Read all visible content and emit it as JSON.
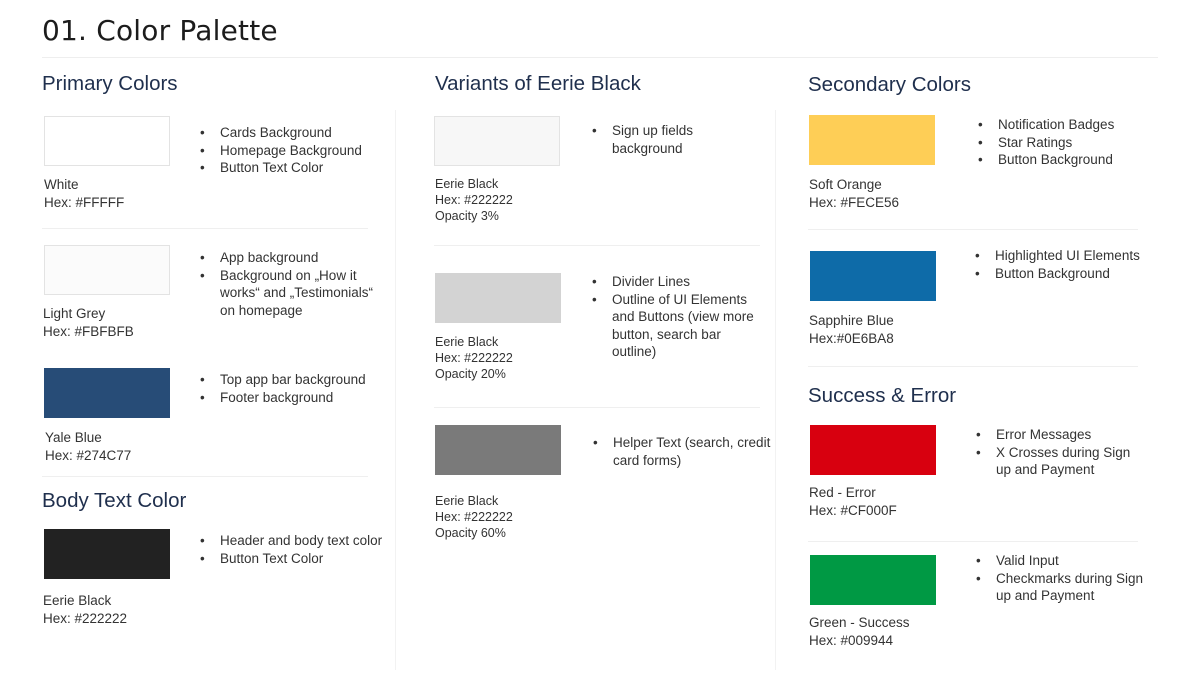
{
  "title": "01. Color Palette",
  "primary": {
    "heading": "Primary Colors",
    "items": [
      {
        "name": "White",
        "hex": "Hex:  #FFFFF",
        "color": "#FFFFFF",
        "uses": [
          "Cards Background",
          "Homepage Background",
          "Button Text Color"
        ]
      },
      {
        "name": "Light Grey",
        "hex": "Hex: #FBFBFB",
        "color": "#FBFBFB",
        "uses": [
          "App background",
          "Background on „How it works“ and „Testimonials“ on homepage"
        ]
      },
      {
        "name": "Yale Blue",
        "hex": "Hex: #274C77",
        "color": "#274C77",
        "uses": [
          "Top app bar background",
          "Footer background"
        ]
      }
    ]
  },
  "body_text": {
    "heading": "Body Text Color",
    "item": {
      "name": "Eerie Black",
      "hex": "Hex: #222222",
      "color": "#222222",
      "uses": [
        "Header and body text color",
        "Button Text Color"
      ]
    }
  },
  "variants": {
    "heading": "Variants of Eerie Black",
    "items": [
      {
        "name": "Eerie Black",
        "hex": "Hex: #222222",
        "opacity": "Opacity 3%",
        "color": "#F7F7F7",
        "uses": [
          "Sign up fields background"
        ]
      },
      {
        "name": "Eerie Black",
        "hex": "Hex: #222222",
        "opacity": "Opacity 20%",
        "color": "#D3D3D3",
        "uses": [
          "Divider Lines",
          "Outline of UI Elements and Buttons (view more button, search bar outline)"
        ]
      },
      {
        "name": "Eerie Black",
        "hex": "Hex: #222222",
        "opacity": "Opacity 60%",
        "color": "#7A7A7A",
        "uses": [
          "Helper Text (search, credit card forms)"
        ]
      }
    ]
  },
  "secondary": {
    "heading": "Secondary Colors",
    "items": [
      {
        "name": "Soft Orange",
        "hex": "Hex: #FECE56",
        "color": "#FECE56",
        "uses": [
          "Notification Badges",
          "Star Ratings",
          "Button Background"
        ]
      },
      {
        "name": "Sapphire Blue",
        "hex": "Hex:#0E6BA8",
        "color": "#0E6BA8",
        "uses": [
          "Highlighted UI Elements",
          "Button Background"
        ]
      }
    ]
  },
  "status": {
    "heading": "Success & Error",
    "items": [
      {
        "name": "Red - Error",
        "hex": "Hex: #CF000F",
        "color": "#D8000F",
        "uses": [
          "Error Messages",
          "X Crosses during Sign up and Payment"
        ]
      },
      {
        "name": "Green - Success",
        "hex": "Hex: #009944",
        "color": "#009944",
        "uses": [
          "Valid Input",
          "Checkmarks during Sign up and Payment"
        ]
      }
    ]
  }
}
